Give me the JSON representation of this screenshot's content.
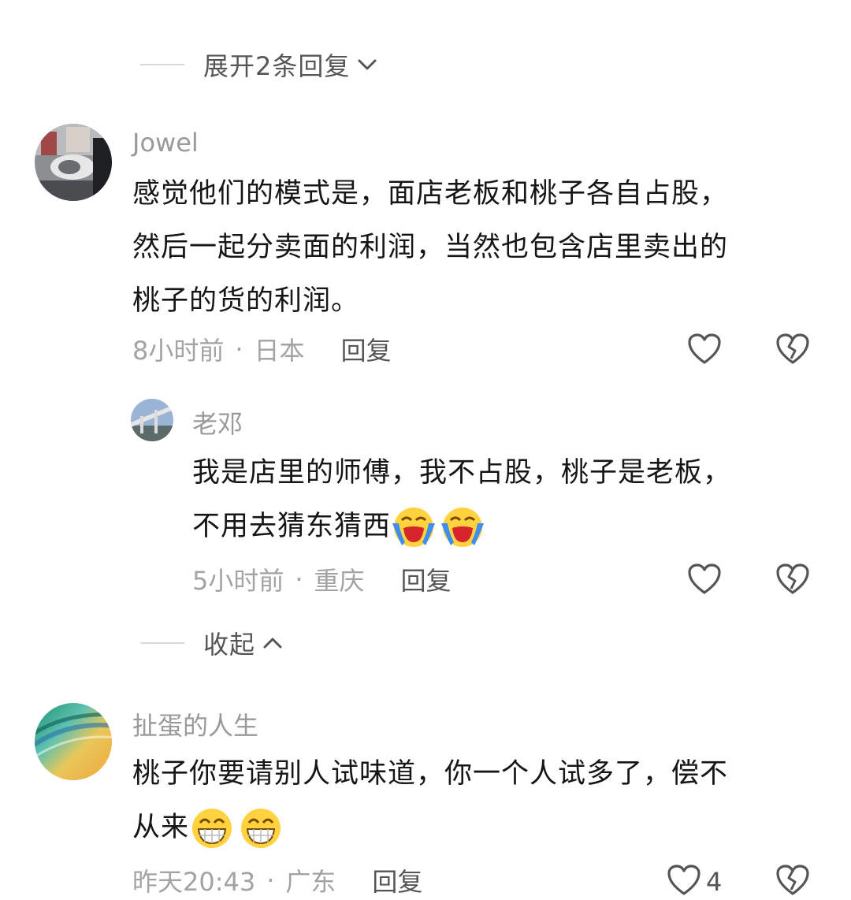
{
  "expand": {
    "label": "展开2条回复"
  },
  "comment1": {
    "username": "Jowel",
    "text1": "感觉他们的模式是，面店老板和桃子各自占股，",
    "text2": "然后一起分卖面的利润，当然也包含店里卖出的",
    "text3": "桃子的货的利润。",
    "time": "8小时前",
    "location": "日本",
    "reply_label": "回复"
  },
  "reply1": {
    "username": "老邓",
    "text1": "我是店里的师傅，我不占股，桃子是老板，",
    "text2": "不用去猜东猜西",
    "emojis": [
      "loudly-crying-emoji",
      "loudly-crying-emoji"
    ],
    "time": "5小时前",
    "location": "重庆",
    "reply_label": "回复"
  },
  "collapse": {
    "label": "收起"
  },
  "comment2": {
    "username": "扯蛋的人生",
    "text1": "桃子你要请别人试味道，你一个人试多了，偿不",
    "text2": "从来",
    "emojis": [
      "grinning-emoji",
      "grinning-emoji"
    ],
    "time": "昨天20:43",
    "location": "广东",
    "reply_label": "回复",
    "like_count": "4"
  },
  "icons": [
    "heart-icon",
    "broken-heart-icon",
    "chevron-down-icon",
    "chevron-up-icon"
  ],
  "colors": {
    "meta_gray": "#a3a3a3",
    "text": "#161616",
    "icon": "#555555"
  }
}
